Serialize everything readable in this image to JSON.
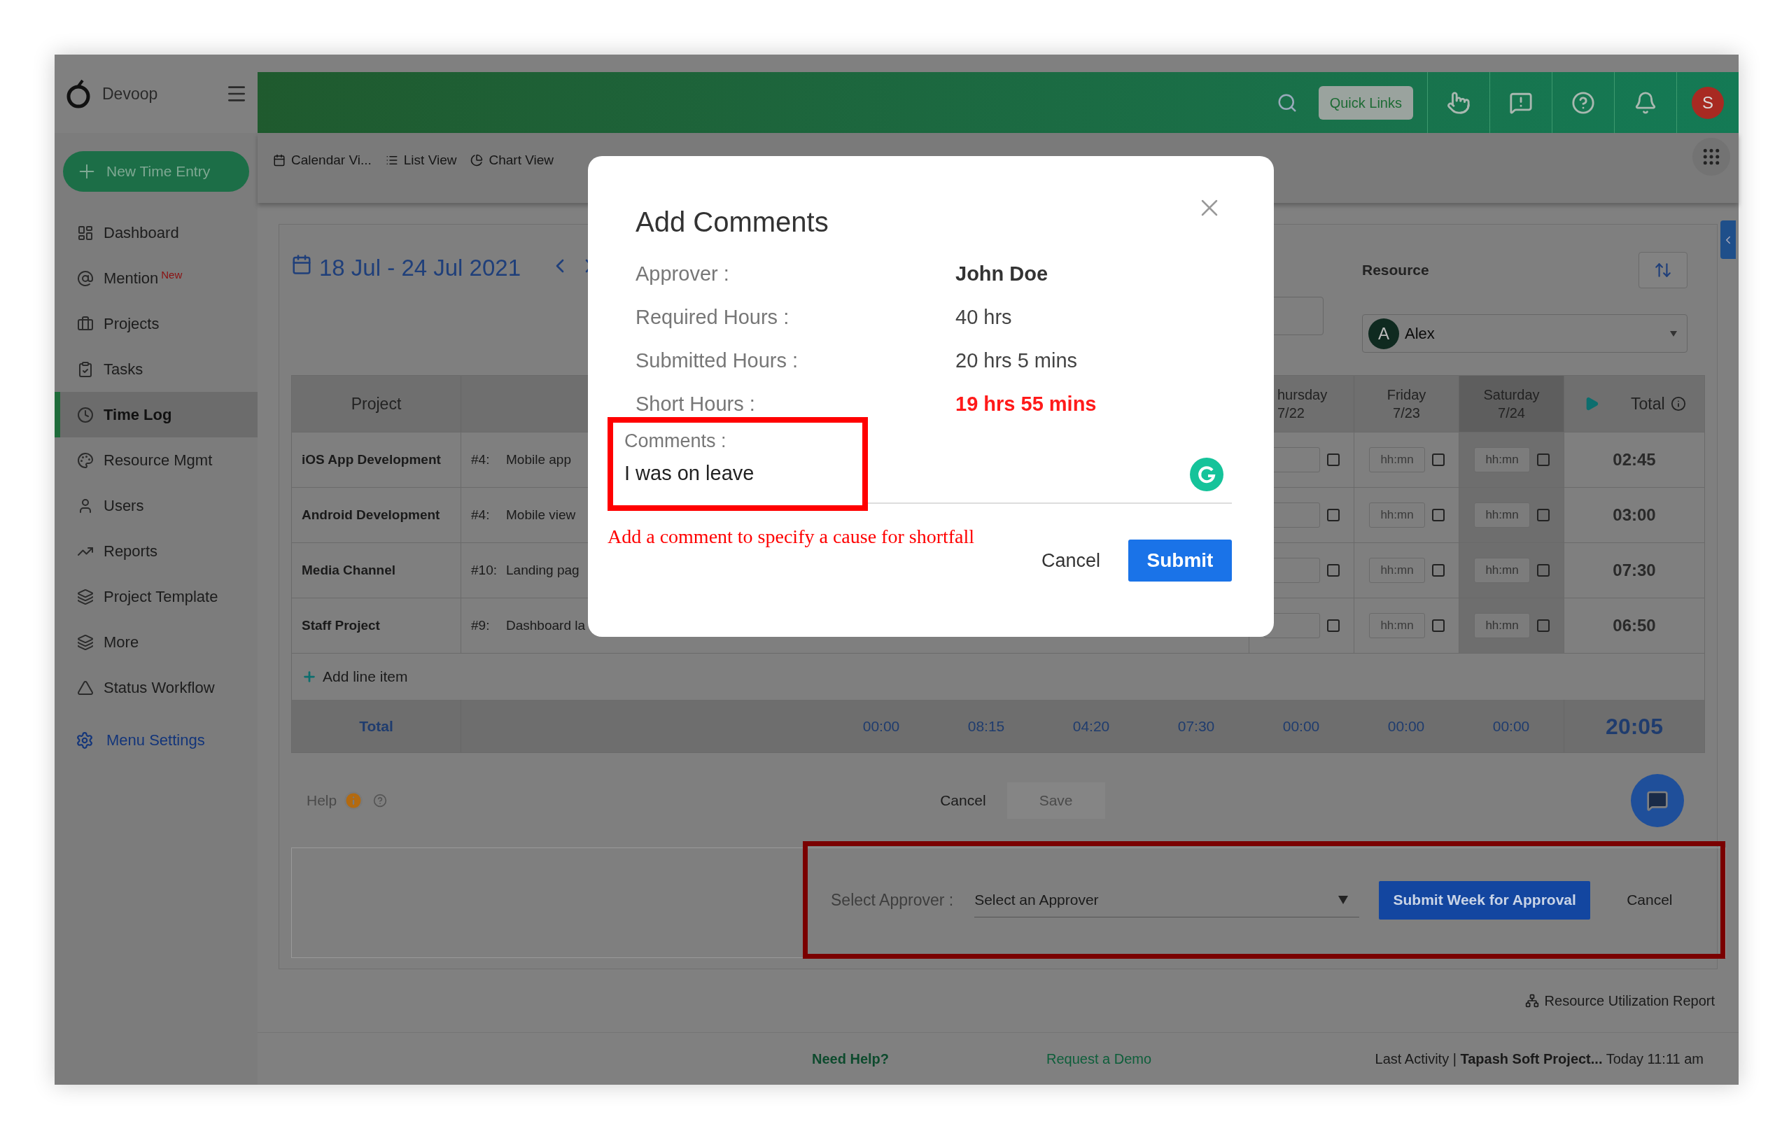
{
  "sidebar": {
    "brand": "Devoop",
    "new_entry": "New Time Entry",
    "items": [
      {
        "label": "Dashboard",
        "selected": false
      },
      {
        "label": "Mention",
        "badge": "New",
        "selected": false
      },
      {
        "label": "Projects",
        "selected": false
      },
      {
        "label": "Tasks",
        "selected": false
      },
      {
        "label": "Time Log",
        "selected": true
      },
      {
        "label": "Resource Mgmt",
        "selected": false
      },
      {
        "label": "Users",
        "selected": false
      },
      {
        "label": "Reports",
        "selected": false
      },
      {
        "label": "Project Template",
        "selected": false
      },
      {
        "label": "More",
        "selected": false
      },
      {
        "label": "Status Workflow",
        "selected": false
      }
    ],
    "menu_settings": "Menu Settings"
  },
  "topbar": {
    "quick_links": "Quick Links",
    "avatar": "S"
  },
  "view_tabs": [
    {
      "label": "Calendar Vi..."
    },
    {
      "label": "List View"
    },
    {
      "label": "Chart View"
    }
  ],
  "week": {
    "range": "18 Jul - 24 Jul 2021"
  },
  "resource": {
    "label": "Resource",
    "value": "Alex",
    "avatar": "A"
  },
  "table": {
    "project_header": "Project",
    "total_header": "Total",
    "day_headers": [
      {
        "day": "hursday",
        "date": "7/22",
        "highlighted": false
      },
      {
        "day": "Friday",
        "date": "7/23",
        "highlighted": false
      },
      {
        "day": "Saturday",
        "date": "7/24",
        "highlighted": true
      }
    ],
    "rows": [
      {
        "project": "iOS App Development",
        "task_no": "#4:",
        "task": "Mobile app",
        "days": [
          {
            "checked": false
          },
          {
            "placeholder": "hh:mn",
            "checked": false
          },
          {
            "placeholder": "hh:mn",
            "checked": false
          }
        ],
        "total": "02:45"
      },
      {
        "project": "Android Development",
        "task_no": "#4:",
        "task": "Mobile view",
        "days": [
          {
            "checked": false
          },
          {
            "placeholder": "hh:mn",
            "checked": false
          },
          {
            "placeholder": "hh:mn",
            "checked": false
          }
        ],
        "total": "03:00"
      },
      {
        "project": "Media Channel",
        "task_no": "#10:",
        "task": "Landing pag",
        "days": [
          {
            "checked": false
          },
          {
            "placeholder": "hh:mn",
            "checked": false
          },
          {
            "placeholder": "hh:mn",
            "checked": false
          }
        ],
        "total": "07:30"
      },
      {
        "project": "Staff Project",
        "task_no": "#9:",
        "task": "Dashboard la",
        "days": [
          {
            "checked": false
          },
          {
            "placeholder": "hh:mn",
            "checked": false
          },
          {
            "placeholder": "hh:mn",
            "checked": false
          }
        ],
        "total": "06:50"
      }
    ],
    "add_line": "Add line item",
    "total_row": {
      "label": "Total",
      "values": [
        "00:00",
        "08:15",
        "04:20",
        "07:30",
        "00:00",
        "00:00",
        "00:00"
      ],
      "grand": "20:05"
    }
  },
  "help": {
    "label": "Help",
    "cancel": "Cancel",
    "save": "Save",
    "save_disabled": true
  },
  "approval": {
    "label": "Select Approver :",
    "placeholder": "Select an Approver",
    "submit": "Submit Week for Approval",
    "cancel": "Cancel"
  },
  "report_link": "Resource Utilization Report",
  "footer": {
    "need_help": "Need Help?",
    "request_demo": "Request a Demo",
    "last_activity": "Last Activity | **Tapash Soft Project...** Today 11:11 am"
  },
  "modal": {
    "title": "Add Comments",
    "fields": [
      {
        "label": "Approver :",
        "value": "John Doe",
        "kind": "strong"
      },
      {
        "label": "Required Hours :",
        "value": "40 hrs",
        "kind": "normal"
      },
      {
        "label": "Submitted Hours :",
        "value": "20 hrs 5 mins",
        "kind": "normal"
      },
      {
        "label": "Short Hours :",
        "value": "19 hrs 55 mins",
        "kind": "alert"
      }
    ],
    "comments": {
      "label": "Comments :",
      "value": "I was on leave"
    },
    "hint": "Add a comment to specify a cause for shortfall",
    "cancel": "Cancel",
    "submit": "Submit"
  }
}
